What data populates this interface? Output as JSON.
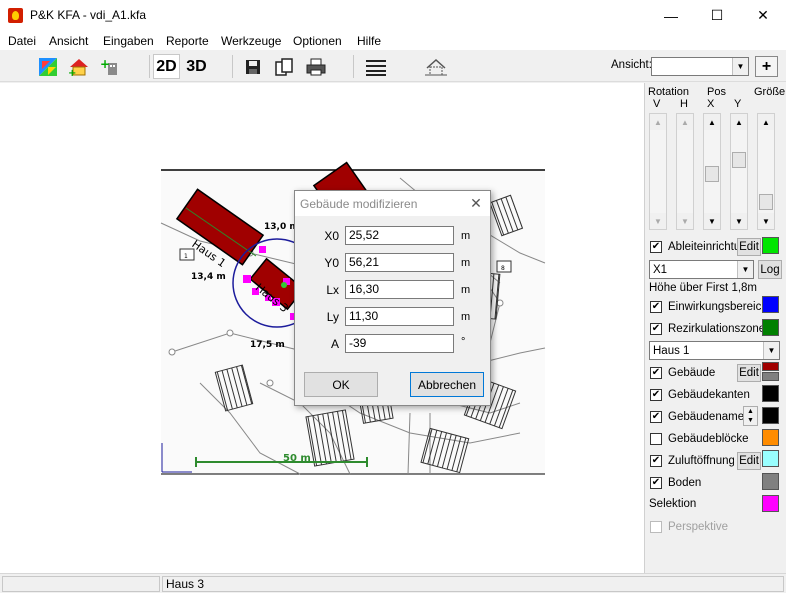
{
  "window": {
    "title": "P&K KFA - vdi_A1.kfa",
    "minimize_glyph": "—",
    "maximize_glyph": "☐",
    "close_glyph": "✕"
  },
  "menu": [
    "Datei",
    "Ansicht",
    "Eingaben",
    "Reporte",
    "Werkzeuge",
    "Optionen",
    "Hilfe"
  ],
  "toolbar": {
    "btn_2d": "2D",
    "btn_3d": "3D",
    "ansicht_label": "Ansicht:",
    "ansicht_value": "",
    "add_label": "+",
    "icons": [
      "color-palette-icon",
      "house-add-icon",
      "building-add-icon",
      "save-icon",
      "copy-icon",
      "print-icon",
      "list-icon",
      "house-roof-icon"
    ]
  },
  "map": {
    "labels": {
      "haus1": "Haus 1",
      "haus3": "Haus 3",
      "dim_130": "13,0 m",
      "dim_134": "13,4 m",
      "dim_175": "17,5 m",
      "scale": "50 m",
      "tag_1": "1",
      "tag_8": "8"
    },
    "colors": {
      "building": "#a00000",
      "selection": "#ff00ff",
      "circle": "#1c1c9c",
      "scale_bar": "#2e8b2e"
    }
  },
  "dialog": {
    "title": "Gebäude modifizieren",
    "fields": [
      {
        "label": "X0",
        "value": "25,52",
        "unit": "m"
      },
      {
        "label": "Y0",
        "value": "56,21",
        "unit": "m"
      },
      {
        "label": "Lx",
        "value": "16,30",
        "unit": "m"
      },
      {
        "label": "Ly",
        "value": "11,30",
        "unit": "m"
      },
      {
        "label": "A",
        "value": "-39",
        "unit": "°"
      }
    ],
    "ok_label": "OK",
    "cancel_label": "Abbrechen"
  },
  "panel": {
    "rotation_label": "Rotation",
    "pos_label": "Pos",
    "groesse_label": "Größe",
    "v_label": "V",
    "h_label": "H",
    "x_label": "X",
    "y_label": "Y",
    "ableit_label": "Ableiteinrichtu",
    "edit_label": "Edit",
    "x1_value": "X1",
    "log_label": "Log",
    "hoehe_label": "Höhe über First 1,8m",
    "einwirkung_label": "Einwirkungsbereich",
    "rezirk_label": "Rezirkulationszone",
    "haus_select": "Haus 1",
    "gebaeude_label": "Gebäude",
    "kanten_label": "Gebäudekanten",
    "namen_label": "Gebäudenamen",
    "bloecke_label": "Gebäudeblöcke",
    "zuluft_label": "Zuluftöffnungen",
    "boden_label": "Boden",
    "selektion_label": "Selektion",
    "perspektive_label": "Perspektive",
    "colors": {
      "ableit": "#00e600",
      "einwirkung": "#0000ff",
      "rezirk": "#008000",
      "gebaeude_top": "#a00000",
      "gebaeude_bottom": "#808080",
      "kanten": "#000000",
      "namen": "#000000",
      "bloecke": "#ff8c00",
      "zuluft": "#99ffff",
      "boden": "#808080",
      "selektion": "#ff00ff"
    }
  },
  "status": {
    "left": "",
    "selection": "Haus 3"
  }
}
